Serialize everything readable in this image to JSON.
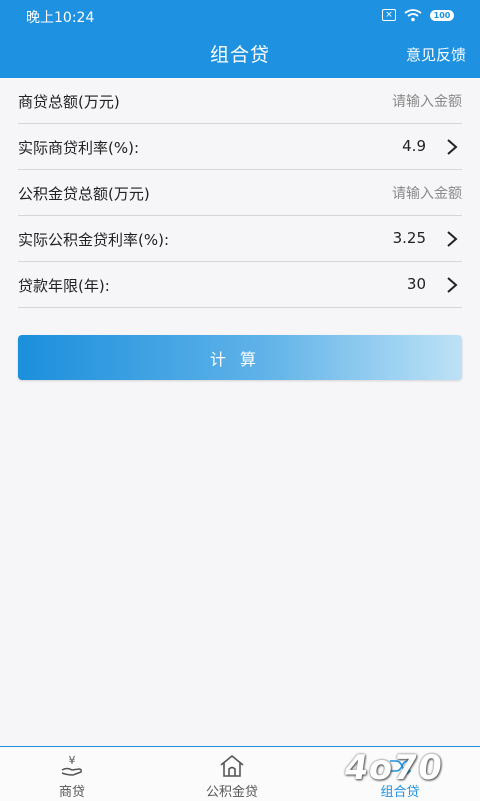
{
  "status": {
    "time": "晚上10:24",
    "sim": "×",
    "battery": "100"
  },
  "header": {
    "title": "组合贷",
    "feedback": "意见反馈"
  },
  "form": {
    "commercial_amount": {
      "label": "商贷总额(万元)",
      "placeholder": "请输入金额"
    },
    "commercial_rate": {
      "label": "实际商贷利率(%):",
      "value": "4.9"
    },
    "fund_amount": {
      "label": "公积金贷总额(万元)",
      "placeholder": "请输入金额"
    },
    "fund_rate": {
      "label": "实际公积金贷利率(%):",
      "value": "3.25"
    },
    "years": {
      "label": "贷款年限(年):",
      "value": "30"
    }
  },
  "calculate_label": "计算",
  "tabs": [
    {
      "label": "商贷",
      "icon": "yen-hand-icon"
    },
    {
      "label": "公积金贷",
      "icon": "house-icon"
    },
    {
      "label": "组合贷",
      "icon": "shuffle-icon",
      "active": true
    }
  ],
  "watermark": "4o70",
  "colors": {
    "primary": "#1e91e0",
    "background": "#f6f6f8"
  }
}
